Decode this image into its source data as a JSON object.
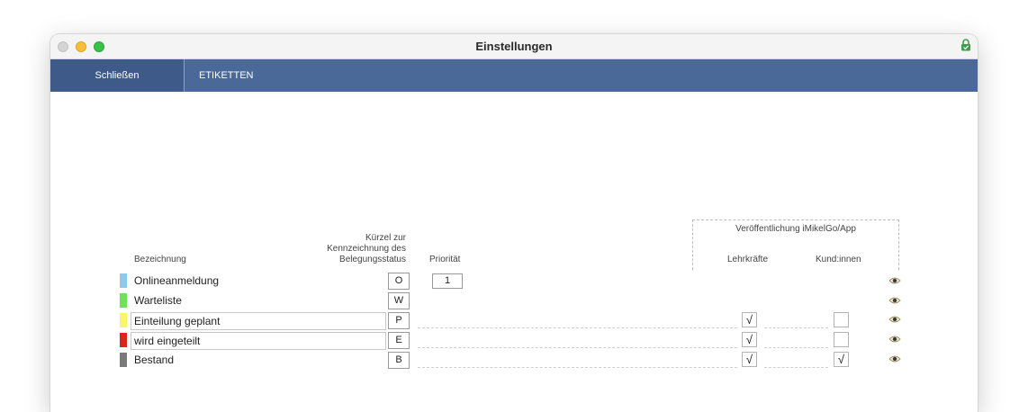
{
  "window": {
    "title": "Einstellungen"
  },
  "toolbar": {
    "close_label": "Schließen",
    "etiketten_label": "ETIKETTEN"
  },
  "table": {
    "headers": {
      "bezeichnung": "Bezeichnung",
      "kuerzel_line1": "Kürzel zur",
      "kuerzel_line2": "Kennzeichnung des",
      "kuerzel_line3": "Belegungsstatus",
      "prioritaet": "Priorität",
      "publication": "Veröffentlichung iMikelGo/App",
      "lehrkraefte": "Lehrkräfte",
      "kundinnen": "Kund:innen"
    },
    "rows": [
      {
        "label": "Onlineanmeldung",
        "code": "O",
        "priority": "1",
        "color": "#8ec9ee",
        "lehrkraefte": null,
        "kundinnen": null
      },
      {
        "label": "Warteliste",
        "code": "W",
        "priority": "",
        "color": "#6ee05a",
        "lehrkraefte": null,
        "kundinnen": null
      },
      {
        "label": "Einteilung geplant",
        "code": "P",
        "priority": "",
        "color": "#f8f56a",
        "lehrkraefte": "√",
        "kundinnen": ""
      },
      {
        "label": "wird eingeteilt",
        "code": "E",
        "priority": "",
        "color": "#d9261c",
        "lehrkraefte": "√",
        "kundinnen": ""
      },
      {
        "label": "Bestand",
        "code": "B",
        "priority": "",
        "color": "#7a7a7a",
        "lehrkraefte": "√",
        "kundinnen": "√"
      }
    ]
  },
  "icons": {
    "lock": "lock-check-icon",
    "visibility": "eye-icon"
  }
}
